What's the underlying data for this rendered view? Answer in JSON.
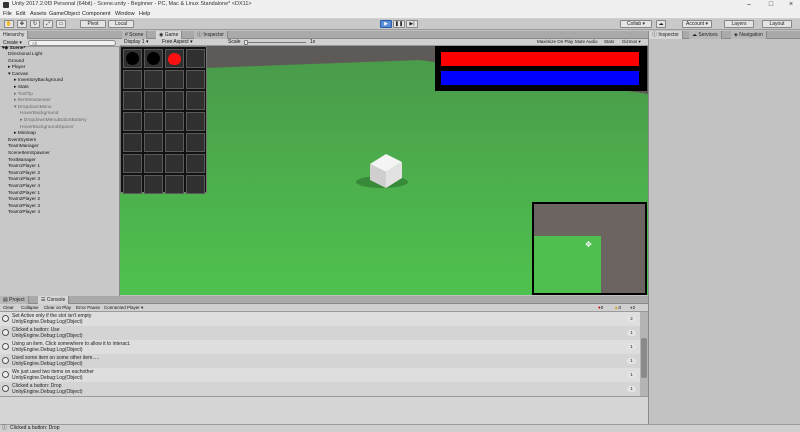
{
  "window": {
    "title": "Unity 2017.2.0f3 Personal (64bit) - Scene.unity - Beginner - PC, Mac & Linux Standalone* <DX11>"
  },
  "menu": [
    "File",
    "Edit",
    "Assets",
    "GameObject",
    "Component",
    "Window",
    "Help"
  ],
  "toolbar": {
    "pivot": "Pivot",
    "local": "Local",
    "collab": "Collab ▾",
    "account": "Account ▾",
    "layers": "Layers",
    "layout": "Layout"
  },
  "hierarchy": {
    "tab": "Hierarchy",
    "create": "Create ▾",
    "search_placeholder": "All",
    "scene": "Scene*",
    "items": [
      {
        "label": "Directional Light",
        "indent": 1,
        "gray": false
      },
      {
        "label": "Ground",
        "indent": 1,
        "gray": false
      },
      {
        "label": "▸ Player",
        "indent": 1,
        "gray": false
      },
      {
        "label": "▾ Canvas",
        "indent": 1,
        "gray": false
      },
      {
        "label": "▸ InventoryBackground",
        "indent": 2,
        "gray": false
      },
      {
        "label": "▸ Stats",
        "indent": 2,
        "gray": false
      },
      {
        "label": "▸ ToolTip",
        "indent": 2,
        "gray": true
      },
      {
        "label": "▸ ItemMouseover",
        "indent": 2,
        "gray": true
      },
      {
        "label": "▾ DropdownMenu",
        "indent": 2,
        "gray": true
      },
      {
        "label": "HoverBackground",
        "indent": 3,
        "gray": true
      },
      {
        "label": "▸ DropdownMenuButtonBattery",
        "indent": 3,
        "gray": true
      },
      {
        "label": "HoverBackgroundSpacer",
        "indent": 3,
        "gray": true
      },
      {
        "label": "▸ Minimap",
        "indent": 2,
        "gray": false
      },
      {
        "label": "EventSystem",
        "indent": 1,
        "gray": false
      },
      {
        "label": "TeamManager",
        "indent": 1,
        "gray": false
      },
      {
        "label": "SceneItemSpawner",
        "indent": 1,
        "gray": false
      },
      {
        "label": "TextManager",
        "indent": 1,
        "gray": false
      },
      {
        "label": "Team1Player 1",
        "indent": 1,
        "gray": false
      },
      {
        "label": "Team1Player 2",
        "indent": 1,
        "gray": false
      },
      {
        "label": "Team1Player 3",
        "indent": 1,
        "gray": false
      },
      {
        "label": "Team1Player 4",
        "indent": 1,
        "gray": false
      },
      {
        "label": "Team2Player 1",
        "indent": 1,
        "gray": false
      },
      {
        "label": "Team2Player 2",
        "indent": 1,
        "gray": false
      },
      {
        "label": "Team2Player 3",
        "indent": 1,
        "gray": false
      },
      {
        "label": "Team2Player 4",
        "indent": 1,
        "gray": false
      }
    ]
  },
  "center_tabs": [
    "Scene",
    "Game",
    "Inspector"
  ],
  "game": {
    "display": "Display 1 ▾",
    "aspect": "Free Aspect ▾",
    "scale_label": "Scale",
    "scale_value": "1x",
    "options": [
      "Maximize On Play",
      "Mute Audio",
      "Stats",
      "Gizmos ▾"
    ],
    "health_color": "#ff0000",
    "mana_color": "#0000ff",
    "health_fraction": 1.0,
    "mana_fraction": 1.0
  },
  "inspector_tabs": [
    "Inspector",
    "Services",
    "Navigation"
  ],
  "console": {
    "tabs": [
      "Project",
      "Console"
    ],
    "buttons": [
      "Clear",
      "Collapse",
      "Clear on Play",
      "Error Pause",
      "Connected Player ▾"
    ],
    "counts": [
      "0",
      "0",
      "2"
    ],
    "entries": [
      {
        "line1": "Set Active only if the slot isn't empty",
        "line2": "UnityEngine.Debug:Log(Object)",
        "count": "2"
      },
      {
        "line1": "Clicked a button: Use",
        "line2": "UnityEngine.Debug:Log(Object)",
        "count": "1"
      },
      {
        "line1": "Using an item. Click somewhere to allow it to interact.",
        "line2": "UnityEngine.Debug:Log(Object)",
        "count": "1"
      },
      {
        "line1": "Used some item on some other item.....",
        "line2": "UnityEngine.Debug:Log(Object)",
        "count": "1"
      },
      {
        "line1": "We just used two items on eachother",
        "line2": "UnityEngine.Debug:Log(Object)",
        "count": "1"
      },
      {
        "line1": "Clicked a button: Drop",
        "line2": "UnityEngine.Debug:Log(Object)",
        "count": "1"
      }
    ]
  },
  "status": {
    "text": "Clicked a button: Drop"
  }
}
